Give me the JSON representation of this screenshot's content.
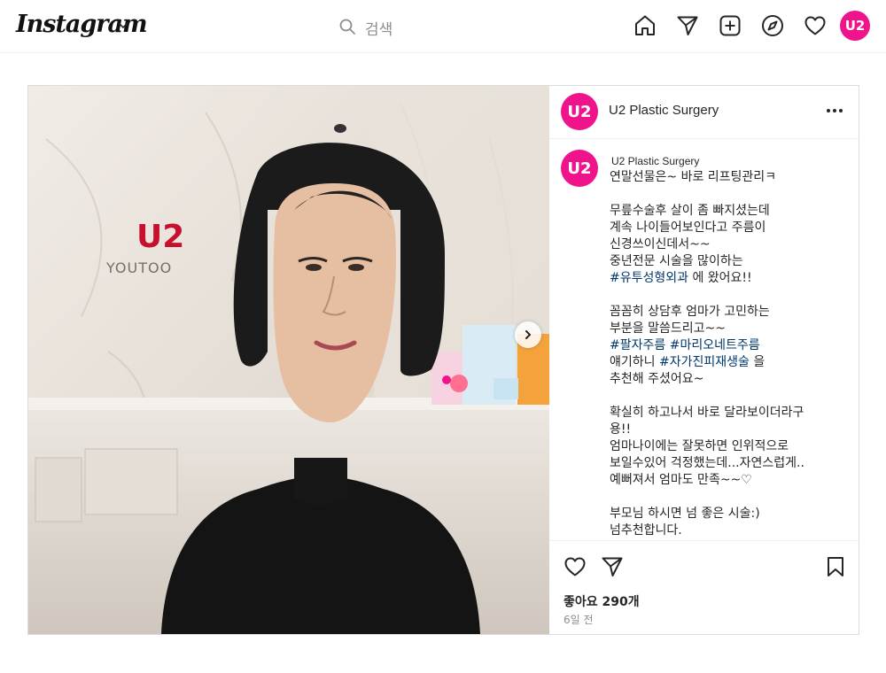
{
  "header": {
    "logo": "Instagram",
    "search_placeholder": "검색"
  },
  "profile_avatar_text": "U2",
  "post": {
    "author": "U2 Plastic Surgery",
    "avatar_text": "U2",
    "photo": {
      "sign_logo": "U2",
      "sign_text": "YOUTOO"
    },
    "caption_lines": [
      [
        {
          "t": "연말선물은~ 바로 리프팅관리ㅋ"
        }
      ],
      [],
      [
        {
          "t": "무릎수술후 살이 좀 빠지셨는데"
        }
      ],
      [
        {
          "t": "계속 나이들어보인다고 주름이"
        }
      ],
      [
        {
          "t": "신경쓰이신데서~~"
        }
      ],
      [
        {
          "t": "중년전문 시술을 많이하는"
        }
      ],
      [
        {
          "t": "#유투성형외과",
          "tag": true
        },
        {
          "t": " 에 왔어요!!"
        }
      ],
      [],
      [
        {
          "t": "꼼꼼히 상담후 엄마가 고민하는"
        }
      ],
      [
        {
          "t": "부분을 말씀드리고~~"
        }
      ],
      [
        {
          "t": "#팔자주름",
          "tag": true
        },
        {
          "t": " "
        },
        {
          "t": "#마리오네트주름",
          "tag": true
        }
      ],
      [
        {
          "t": "얘기하니 "
        },
        {
          "t": "#자가진피재생술",
          "tag": true
        },
        {
          "t": " 을"
        }
      ],
      [
        {
          "t": "추천해 주셨어요~"
        }
      ],
      [],
      [
        {
          "t": "확실히 하고나서 바로 달라보이더라구"
        }
      ],
      [
        {
          "t": "용!!"
        }
      ],
      [
        {
          "t": "엄마나이에는 잘못하면 인위적으로"
        }
      ],
      [
        {
          "t": "보일수있어 걱정했는데...자연스럽게.."
        }
      ],
      [
        {
          "t": "예뻐져서 엄마도 만족~~♡"
        }
      ],
      [],
      [
        {
          "t": "부모님 하시면 넘 좋은 시술:)"
        }
      ],
      [
        {
          "t": "넘추천합니다."
        }
      ]
    ],
    "likes": "좋아요 290개",
    "time_ago": "6일 전"
  },
  "colors": {
    "brand_pink": "#f0148c",
    "hashtag": "#00376b",
    "muted": "#8e8e8e"
  },
  "icons": [
    "chevron-down-icon",
    "search-icon",
    "home-icon",
    "send-icon",
    "new-post-icon",
    "explore-icon",
    "heart-icon",
    "more-icon",
    "next-arrow-icon",
    "bookmark-icon"
  ]
}
